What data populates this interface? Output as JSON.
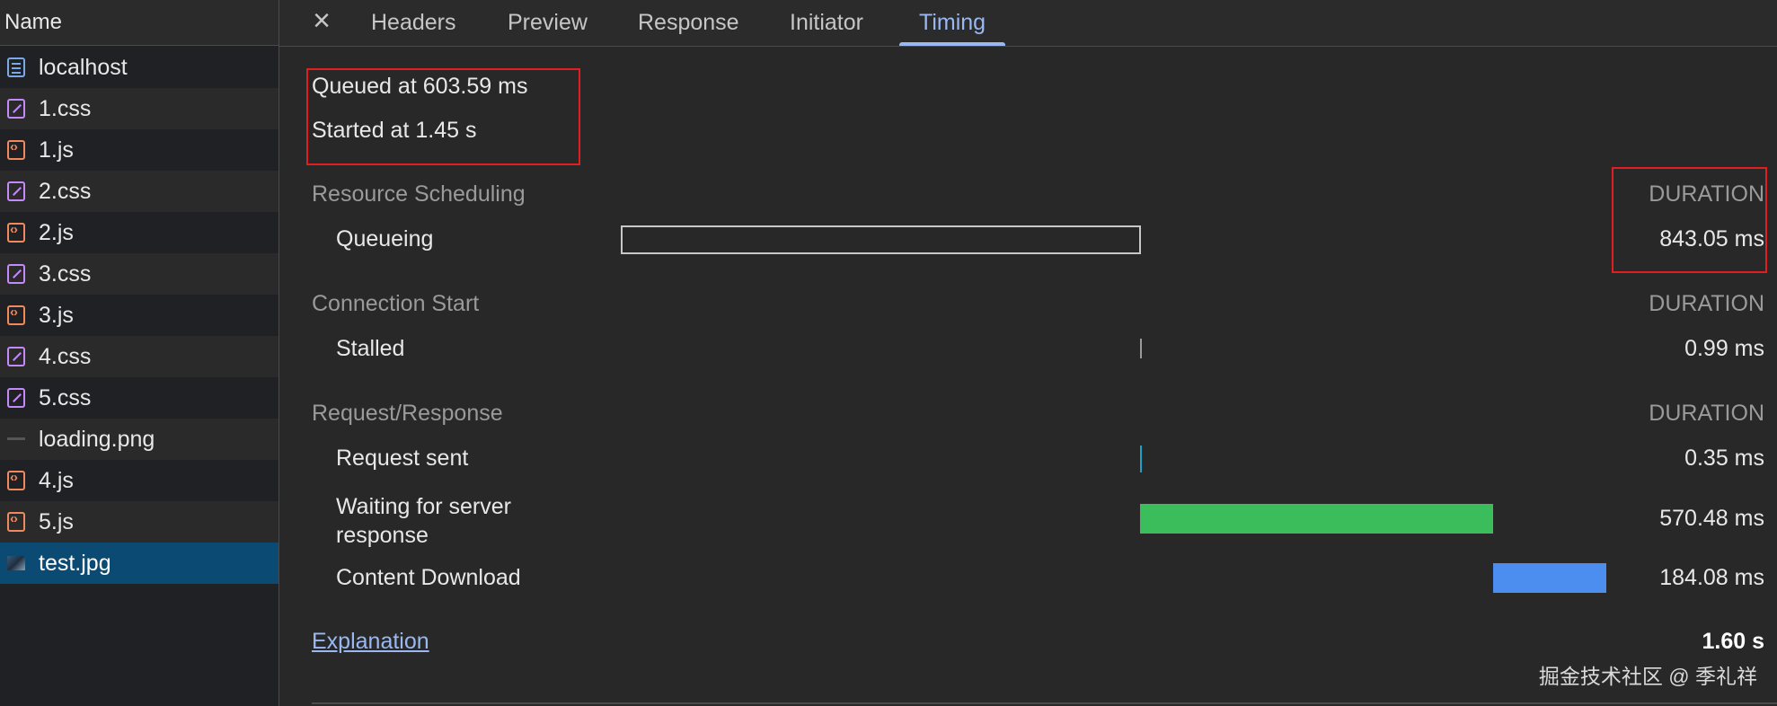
{
  "file_list": {
    "header": "Name",
    "items": [
      {
        "name": "localhost",
        "icon": "document-icon",
        "type": "doc"
      },
      {
        "name": "1.css",
        "icon": "stylesheet-icon",
        "type": "css"
      },
      {
        "name": "1.js",
        "icon": "script-icon",
        "type": "js"
      },
      {
        "name": "2.css",
        "icon": "stylesheet-icon",
        "type": "css"
      },
      {
        "name": "2.js",
        "icon": "script-icon",
        "type": "js"
      },
      {
        "name": "3.css",
        "icon": "stylesheet-icon",
        "type": "css"
      },
      {
        "name": "3.js",
        "icon": "script-icon",
        "type": "js"
      },
      {
        "name": "4.css",
        "icon": "stylesheet-icon",
        "type": "css"
      },
      {
        "name": "5.css",
        "icon": "stylesheet-icon",
        "type": "css"
      },
      {
        "name": "loading.png",
        "icon": "image-thumbnail-icon",
        "type": "png"
      },
      {
        "name": "4.js",
        "icon": "script-icon",
        "type": "js"
      },
      {
        "name": "5.js",
        "icon": "script-icon",
        "type": "js"
      },
      {
        "name": "test.jpg",
        "icon": "image-thumbnail-icon",
        "type": "jpg",
        "selected": true
      }
    ]
  },
  "tabs": {
    "close_icon": "close-icon",
    "items": [
      "Headers",
      "Preview",
      "Response",
      "Initiator",
      "Timing"
    ],
    "active": "Timing"
  },
  "timing": {
    "queued_at": "Queued at 603.59 ms",
    "started_at": "Started at 1.45 s",
    "sections": {
      "resource_scheduling": {
        "title": "Resource Scheduling",
        "duration_label": "DURATION",
        "rows": [
          {
            "label": "Queueing",
            "value": "843.05 ms"
          }
        ]
      },
      "connection_start": {
        "title": "Connection Start",
        "duration_label": "DURATION",
        "rows": [
          {
            "label": "Stalled",
            "value": "0.99 ms"
          }
        ]
      },
      "request_response": {
        "title": "Request/Response",
        "duration_label": "DURATION",
        "rows": [
          {
            "label": "Request sent",
            "value": "0.35 ms"
          },
          {
            "label": "Waiting for server response",
            "value": "570.48 ms"
          },
          {
            "label": "Content Download",
            "value": "184.08 ms"
          }
        ]
      }
    },
    "explanation_link": "Explanation",
    "total": "1.60 s"
  },
  "colors": {
    "queueing_bar_border": "#c8c8c8",
    "stalled_bar": "#9a9a9a",
    "request_sent_bar": "#1ea0c8",
    "waiting_bar": "#3bbd5c",
    "download_bar": "#4c8df0",
    "accent": "#9ab9f2",
    "annotation_box": "#e02020"
  },
  "watermark": "掘金技术社区 @ 季礼祥"
}
